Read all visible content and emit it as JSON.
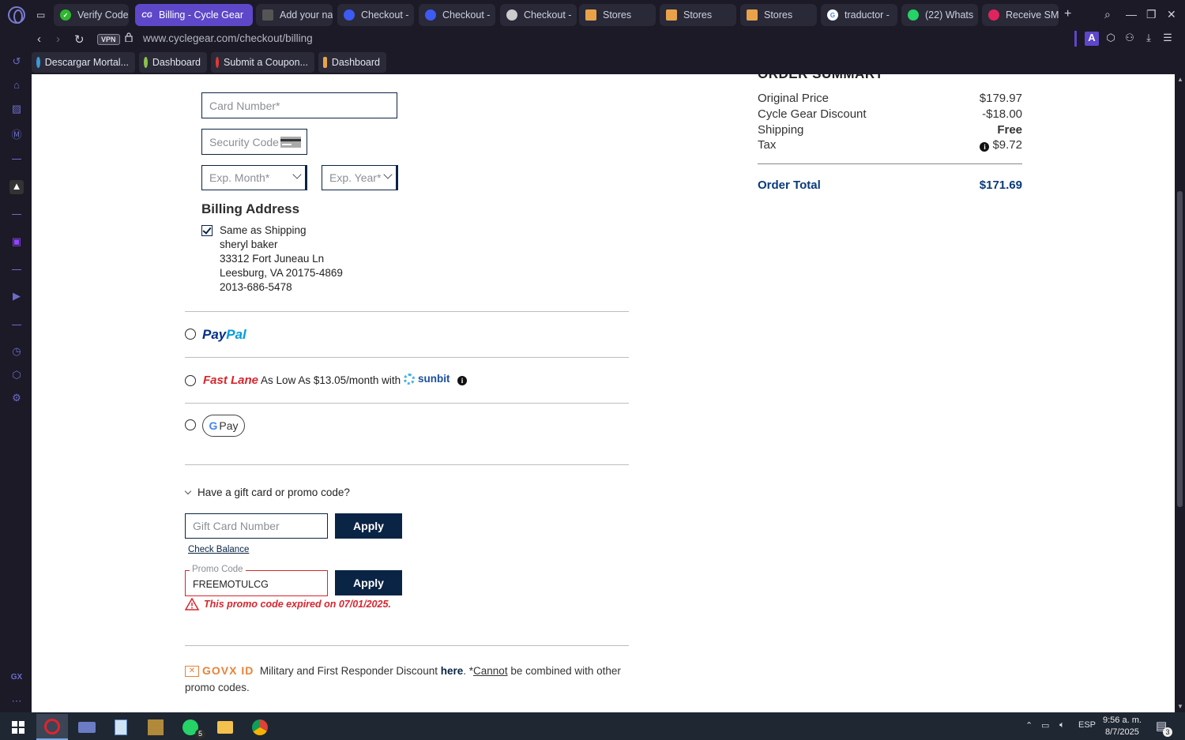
{
  "tabs": [
    {
      "label": "Verify Code",
      "color": "#2eb82e",
      "active": false
    },
    {
      "label": "Billing - Cycle Gear",
      "color": "#1a3a7a",
      "active": true,
      "fav": "CG"
    },
    {
      "label": "Add your na",
      "color": "#888888",
      "active": false
    },
    {
      "label": "Checkout -",
      "color": "#3d5af1",
      "active": false
    },
    {
      "label": "Checkout -",
      "color": "#3d5af1",
      "active": false
    },
    {
      "label": "Checkout -",
      "color": "#cccccc",
      "active": false
    },
    {
      "label": "Stores",
      "color": "#e8a34a",
      "active": false
    },
    {
      "label": "Stores",
      "color": "#e8a34a",
      "active": false
    },
    {
      "label": "Stores",
      "color": "#e8a34a",
      "active": false
    },
    {
      "label": "traductor -",
      "color": "#4285f4",
      "active": false
    },
    {
      "label": "(22) Whats",
      "color": "#25d366",
      "active": false
    },
    {
      "label": "Receive SM",
      "color": "#e0245e",
      "active": false
    }
  ],
  "address": {
    "vpn": "VPN",
    "url": "www.cyclegear.com/checkout/billing"
  },
  "bookmarks": [
    {
      "label": "Descargar Mortal...",
      "color": "#3a9ad9"
    },
    {
      "label": "Dashboard",
      "color": "#8bc34a"
    },
    {
      "label": "Submit a Coupon...",
      "color": "#e53935"
    },
    {
      "label": "Dashboard",
      "color": "#e8a34a"
    }
  ],
  "payment": {
    "card_number_placeholder": "Card Number*",
    "security_code_placeholder": "Security Code",
    "exp_month_placeholder": "Exp. Month*",
    "exp_year_placeholder": "Exp. Year*"
  },
  "billing": {
    "heading": "Billing Address",
    "same_as_shipping": "Same as Shipping",
    "same_as_shipping_checked": true,
    "name": "sheryl baker",
    "street": "33312 Fort Juneau Ln",
    "city_state_zip": "Leesburg, VA 20175-4869",
    "phone": "2013-686-5478"
  },
  "methods": {
    "paypal_pay": "Pay",
    "paypal_pal": "Pal",
    "fastlane_brand": "Fast Lane",
    "fastlane_text": "As Low As $13.05/month with",
    "sunbit": "sunbit",
    "gpay_g": "G",
    "gpay_pay": "Pay"
  },
  "promo": {
    "toggle_label": "Have a gift card or promo code?",
    "gift_card_placeholder": "Gift Card Number",
    "apply_label": "Apply",
    "check_balance": "Check Balance",
    "promo_legend": "Promo Code",
    "promo_value": "FREEMOTULCG",
    "error": "This promo code expired on 07/01/2025."
  },
  "govx": {
    "logo": "GOVX ID",
    "text": "Military and First Responder Discount",
    "here": "here",
    "note_star": ". *",
    "cannot": "Cannot",
    "note_rest": "be combined with other promo codes."
  },
  "summary": {
    "heading": "ORDER SUMMARY",
    "rows": [
      {
        "label": "Original Price",
        "value": "$179.97"
      },
      {
        "label": "Cycle Gear Discount",
        "value": "-$18.00"
      },
      {
        "label": "Shipping",
        "value": "Free"
      },
      {
        "label": "Tax",
        "value": "$9.72"
      }
    ],
    "total_label": "Order Total",
    "total_value": "$171.69"
  },
  "taskbar": {
    "lang": "ESP",
    "time": "9:56 a. m.",
    "date": "8/7/2025",
    "whatsapp_badge": "5",
    "notif_badge": "3"
  },
  "colors": {
    "accent": "#5e47c9",
    "brand_navy": "#0a2445",
    "error": "#d7262f"
  }
}
